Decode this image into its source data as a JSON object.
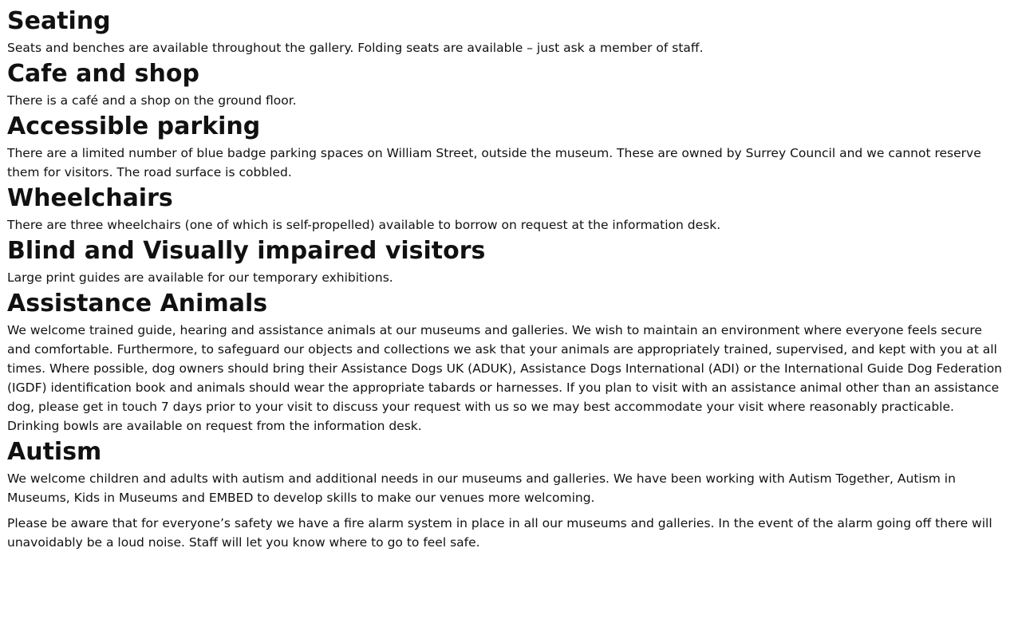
{
  "sections": [
    {
      "heading": "Seating",
      "paragraphs": [
        "Seats and benches are available throughout the gallery. Folding seats are available – just ask a member of staff."
      ]
    },
    {
      "heading": "Cafe and shop",
      "paragraphs": [
        "There is a café and a shop on the ground floor."
      ]
    },
    {
      "heading": "Accessible parking",
      "paragraphs": [
        "There are a limited number of blue badge parking spaces on William Street, outside the museum. These are owned by Surrey Council and we cannot reserve them for visitors. The road surface is cobbled."
      ]
    },
    {
      "heading": "Wheelchairs",
      "paragraphs": [
        "There are three wheelchairs (one of which is self-propelled) available to borrow on request at the information desk."
      ]
    },
    {
      "heading": "Blind and Visually impaired visitors",
      "paragraphs": [
        "Large print guides are available for our temporary exhibitions."
      ]
    },
    {
      "heading": "Assistance Animals",
      "paragraphs": [
        "We welcome trained guide, hearing and assistance animals at our museums and galleries. We wish to maintain an environment where everyone feels secure and comfortable. Furthermore, to safeguard our objects and collections we ask that your animals are appropriately trained, supervised, and kept with you at all times. Where possible, dog owners should bring their Assistance Dogs UK (ADUK), Assistance Dogs International (ADI) or the International Guide Dog Federation (IGDF) identification book and animals should wear the appropriate tabards or harnesses.  If you plan to visit with an assistance animal other than an assistance dog, please get in touch 7 days prior to your visit to discuss your request with us so we may best accommodate your visit where reasonably practicable. Drinking bowls are available on request from the information desk."
      ]
    },
    {
      "heading": "Autism",
      "paragraphs": [
        "We welcome children and adults with autism and additional needs in our museums and galleries. We have been working with Autism Together, Autism in Museums, Kids in Museums and EMBED to develop skills to make our venues more welcoming.",
        "Please be aware that for everyone’s safety we have a fire alarm system in place in all our museums and galleries. In the event of the alarm going off there will unavoidably be a loud noise. Staff will let you know where to go to feel safe."
      ]
    }
  ]
}
